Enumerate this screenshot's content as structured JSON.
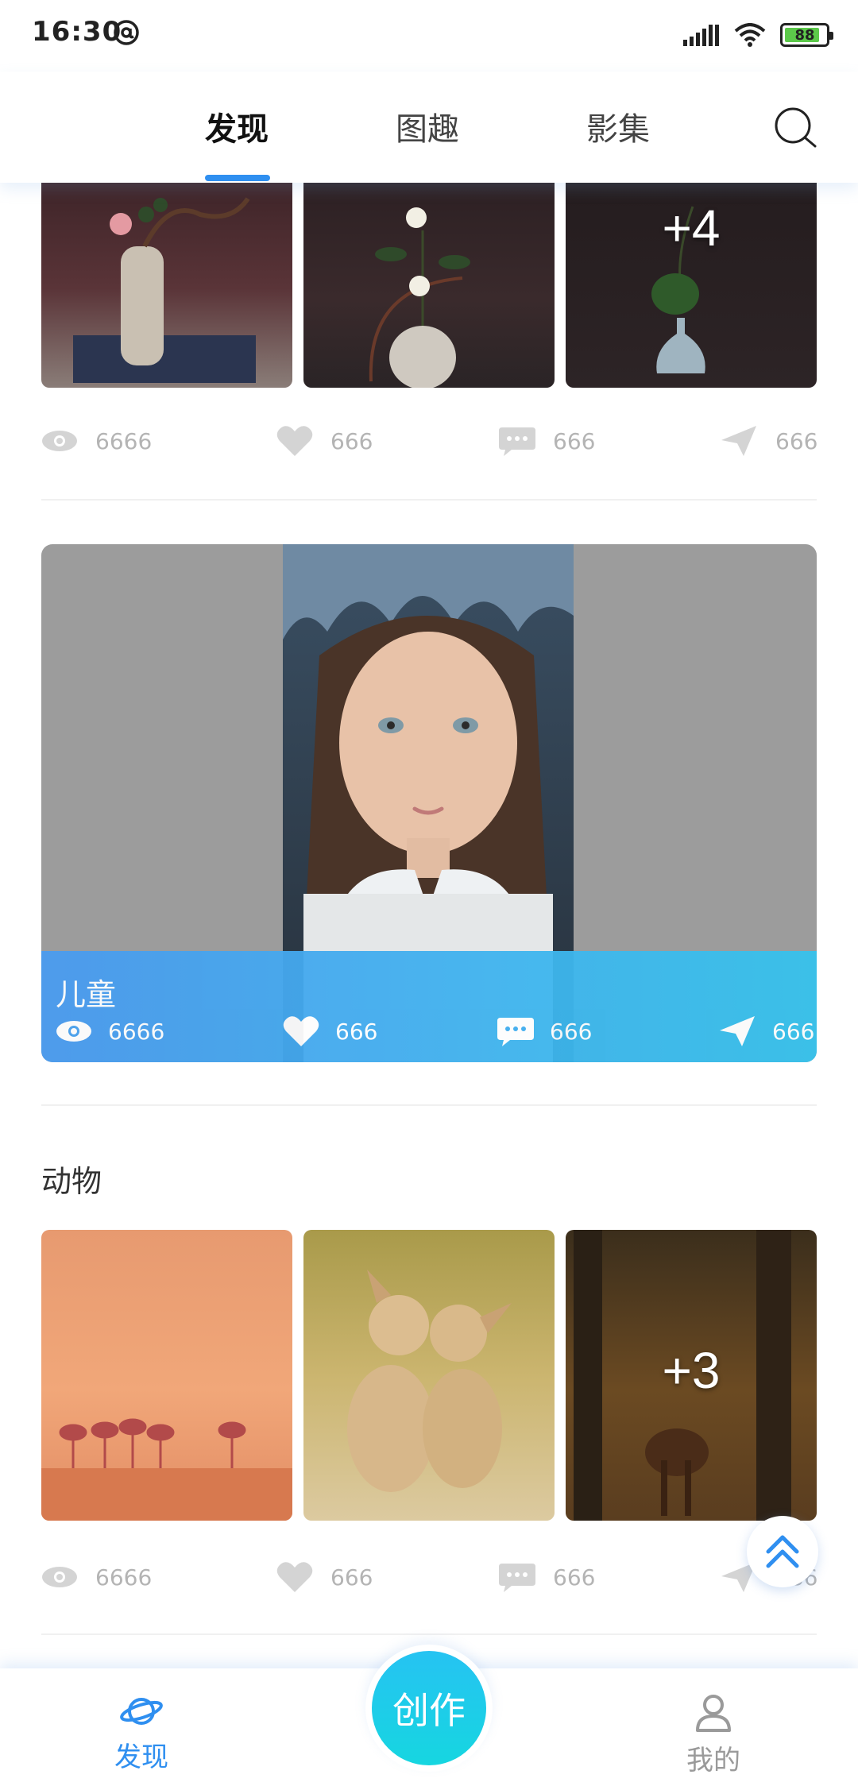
{
  "status_bar": {
    "time": "16:30",
    "battery": "88",
    "battery_level": 0.88
  },
  "header": {
    "tabs": [
      {
        "label": "发现",
        "active": true
      },
      {
        "label": "图趣",
        "active": false
      },
      {
        "label": "影集",
        "active": false
      }
    ],
    "search_icon": "search-icon"
  },
  "posts": [
    {
      "title": "",
      "more_count_label": "+4",
      "stats": {
        "views": "6666",
        "likes": "666",
        "comments": "666",
        "shares": "666"
      }
    },
    {
      "title": "儿童",
      "stats": {
        "views": "6666",
        "likes": "666",
        "comments": "666",
        "shares": "666"
      }
    },
    {
      "title": "动物",
      "more_count_label": "+3",
      "stats": {
        "views": "6666",
        "likes": "666",
        "comments": "666",
        "shares": "666"
      }
    }
  ],
  "bottom_nav": {
    "discover": "发现",
    "create": "创作",
    "mine": "我的"
  },
  "colors": {
    "accent": "#2f8ff0",
    "create_button": "#1ccde8",
    "stat_gray": "#b4b4b4"
  }
}
